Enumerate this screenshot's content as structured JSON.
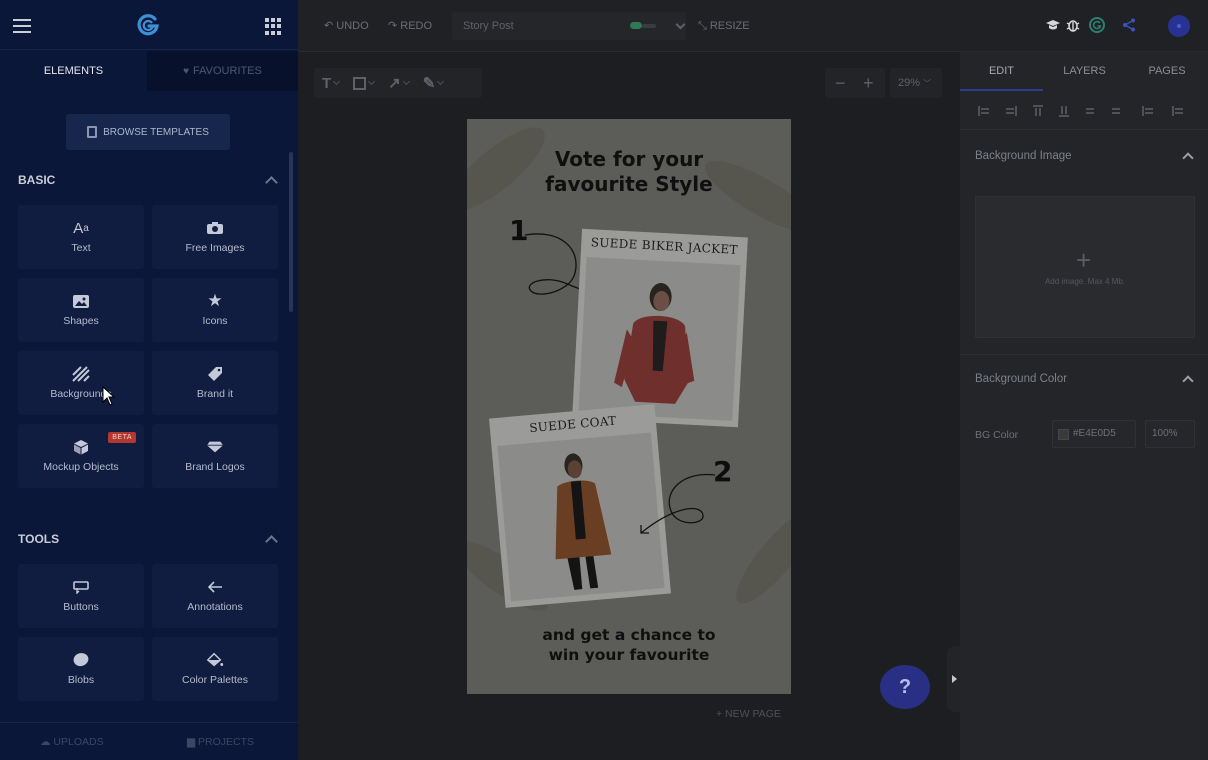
{
  "sidebar": {
    "tabs": {
      "elements": "ELEMENTS",
      "favourites": "FAVOURITES"
    },
    "browse_templates": "BROWSE TEMPLATES",
    "sections": [
      {
        "title": "BASIC",
        "items": [
          {
            "label": "Text",
            "icon": "text-icon"
          },
          {
            "label": "Free Images",
            "icon": "camera-icon"
          },
          {
            "label": "Shapes",
            "icon": "image-icon"
          },
          {
            "label": "Icons",
            "icon": "star-icon"
          },
          {
            "label": "Backgrounds",
            "icon": "stripes-icon"
          },
          {
            "label": "Brand it",
            "icon": "tag-icon"
          },
          {
            "label": "Mockup Objects",
            "icon": "cube-icon",
            "badge": "BETA"
          },
          {
            "label": "Brand Logos",
            "icon": "diamond-icon"
          }
        ]
      },
      {
        "title": "TOOLS",
        "items": [
          {
            "label": "Buttons",
            "icon": "button-icon"
          },
          {
            "label": "Annotations",
            "icon": "arrow-left-icon"
          },
          {
            "label": "Blobs",
            "icon": "blob-icon"
          },
          {
            "label": "Color Palettes",
            "icon": "paint-bucket-icon"
          }
        ]
      }
    ],
    "bottom": {
      "uploads": "UPLOADS",
      "projects": "PROJECTS"
    }
  },
  "topbar": {
    "undo": "UNDO",
    "redo": "REDO",
    "document_name": "Story Post",
    "resize": "RESIZE"
  },
  "canvas": {
    "zoom": "29%",
    "new_page": "+ NEW PAGE",
    "help": "?",
    "story": {
      "title_line1": "Vote for your",
      "title_line2": "favourite Style",
      "card1_caption": "SUEDE BIKER JACKET",
      "card2_caption": "SUEDE COAT",
      "number1": "1",
      "number2": "2",
      "footer_line1": "and get a chance to",
      "footer_line2": "win your favourite"
    }
  },
  "right_panel": {
    "tabs": {
      "edit": "EDIT",
      "layers": "LAYERS",
      "pages": "PAGES"
    },
    "background_image": {
      "title": "Background Image",
      "hint": "Add image. Max 4 Mb."
    },
    "background_color": {
      "title": "Background Color",
      "label": "BG Color",
      "value": "#E4E0D5",
      "opacity": "100%"
    }
  },
  "colors": {
    "accent": "#2b3e8f",
    "sidebar_bg": "#0b1738",
    "beta_badge": "#b2372f"
  }
}
